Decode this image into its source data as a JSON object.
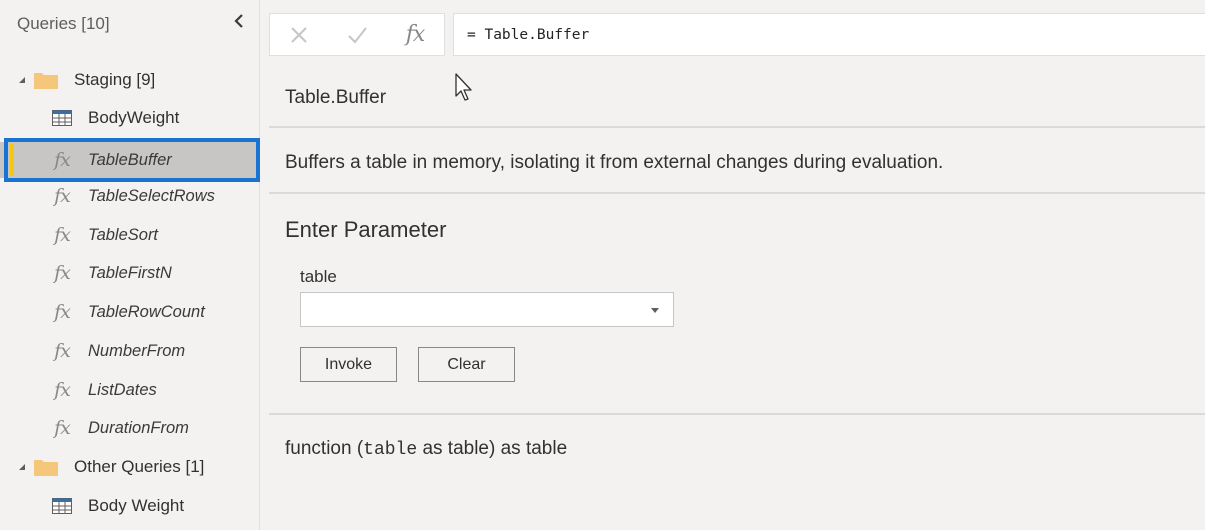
{
  "sidebar": {
    "title": "Queries [10]",
    "collapse_icon": "chevron-left-icon",
    "groups": [
      {
        "label": "Staging [9]",
        "icon": "folder-icon",
        "items": [
          {
            "label": "BodyWeight",
            "type": "table",
            "icon": "table-icon"
          },
          {
            "label": "TableBuffer",
            "type": "function",
            "icon": "fx-icon",
            "selected": true
          },
          {
            "label": "TableSelectRows",
            "type": "function",
            "icon": "fx-icon"
          },
          {
            "label": "TableSort",
            "type": "function",
            "icon": "fx-icon"
          },
          {
            "label": "TableFirstN",
            "type": "function",
            "icon": "fx-icon"
          },
          {
            "label": "TableRowCount",
            "type": "function",
            "icon": "fx-icon"
          },
          {
            "label": "NumberFrom",
            "type": "function",
            "icon": "fx-icon"
          },
          {
            "label": "ListDates",
            "type": "function",
            "icon": "fx-icon"
          },
          {
            "label": "DurationFrom",
            "type": "function",
            "icon": "fx-icon"
          }
        ]
      },
      {
        "label": "Other Queries [1]",
        "icon": "folder-icon",
        "items": [
          {
            "label": "Body Weight",
            "type": "table",
            "icon": "table-icon"
          }
        ]
      }
    ]
  },
  "formula_bar": {
    "cancel_icon": "close-icon",
    "commit_icon": "check-icon",
    "fx_label": "fx",
    "formula": "= Table.Buffer"
  },
  "function_info": {
    "title": "Table.Buffer",
    "description": "Buffers a table in memory, isolating it from external changes during evaluation."
  },
  "parameters": {
    "heading": "Enter Parameter",
    "fields": [
      {
        "label": "table",
        "value": ""
      }
    ],
    "invoke_label": "Invoke",
    "clear_label": "Clear"
  },
  "signature": {
    "prefix": "function (",
    "param_name": "table",
    "suffix": " as table) as table"
  },
  "colors": {
    "selection_outline": "#1a73d1",
    "selection_bar": "#f2c811",
    "selection_bg": "#c8c6c4",
    "folder": "#f4c77a",
    "background": "#f3f2f1"
  }
}
